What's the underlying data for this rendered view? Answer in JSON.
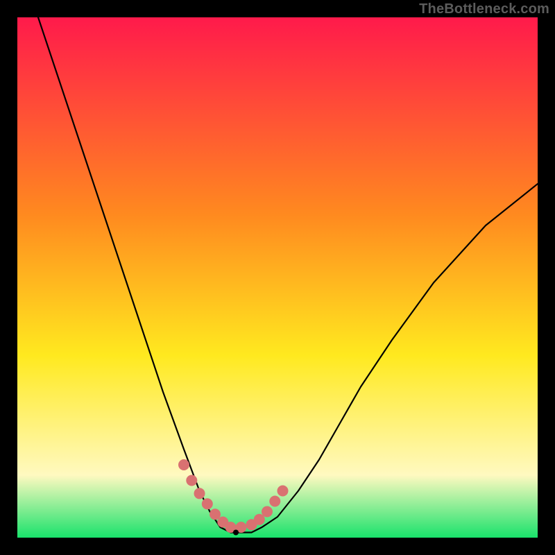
{
  "watermark": "TheBottleneck.com",
  "colors": {
    "bg_black": "#000000",
    "grad_top": "#ff1a4b",
    "grad_mid1": "#ff8a1f",
    "grad_mid2": "#ffe91f",
    "grad_low": "#fff9c0",
    "grad_bottom": "#19e26b",
    "curve": "#000000",
    "marker": "#d97171"
  },
  "chart_data": {
    "type": "line",
    "title": "",
    "xlabel": "",
    "ylabel": "",
    "xlim": [
      0,
      100
    ],
    "ylim": [
      0,
      100
    ],
    "series": [
      {
        "name": "bottleneck-curve",
        "x": [
          4,
          8,
          12,
          16,
          20,
          24,
          28,
          32,
          35,
          37,
          39,
          41,
          43,
          45,
          47,
          50,
          54,
          58,
          62,
          66,
          72,
          80,
          90,
          100
        ],
        "y": [
          100,
          88,
          76,
          64,
          52,
          40,
          28,
          17,
          9,
          5,
          2,
          1,
          1,
          1,
          2,
          4,
          9,
          15,
          22,
          29,
          38,
          49,
          60,
          68
        ]
      }
    ],
    "markers": {
      "name": "highlight-dots",
      "x": [
        32,
        33.5,
        35,
        36.5,
        38,
        39.5,
        41,
        43,
        45,
        46.5,
        48,
        49.5,
        51
      ],
      "y": [
        14,
        11,
        8.5,
        6.5,
        4.5,
        3,
        2,
        2,
        2.5,
        3.5,
        5,
        7,
        9
      ]
    },
    "min_point": {
      "x": 42,
      "y": 1
    }
  }
}
